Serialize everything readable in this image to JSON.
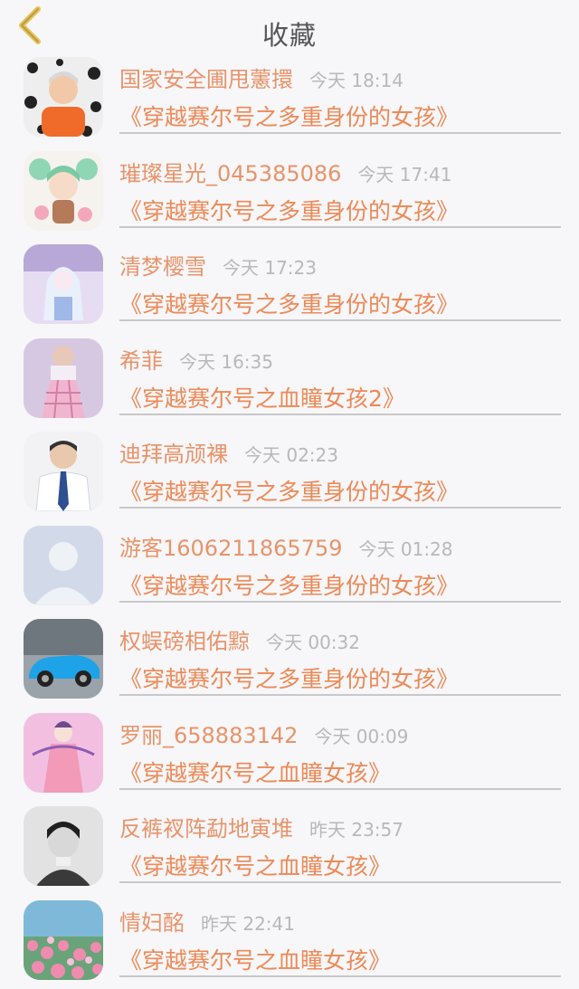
{
  "header": {
    "title": "收藏",
    "back_icon": "chevron-left-icon",
    "accent": "#e9c24f"
  },
  "colors": {
    "name": "#e8946a",
    "book": "#ec8a57",
    "time": "#b8b8b8",
    "background": "#f7f6f8"
  },
  "favorites": [
    {
      "user": "国家安全圃甩藼擐",
      "time": "今天 18:14",
      "book": "《穿越赛尔号之多重身份的女孩》",
      "avatar": "avatar-boy-orange"
    },
    {
      "user": "璀璨星光_045385086",
      "time": "今天 17:41",
      "book": "《穿越赛尔号之多重身份的女孩》",
      "avatar": "avatar-anime-green"
    },
    {
      "user": "清梦樱雪",
      "time": "今天 17:23",
      "book": "《穿越赛尔号之多重身份的女孩》",
      "avatar": "avatar-anime-purple"
    },
    {
      "user": "希菲",
      "time": "今天 16:35",
      "book": "《穿越赛尔号之血瞳女孩2》",
      "avatar": "avatar-girl-pink"
    },
    {
      "user": "迪拜高颃裸",
      "time": "今天 02:23",
      "book": "《穿越赛尔号之多重身份的女孩》",
      "avatar": "avatar-man-suit"
    },
    {
      "user": "游客1606211865759",
      "time": "今天 01:28",
      "book": "《穿越赛尔号之多重身份的女孩》",
      "avatar": "avatar-default"
    },
    {
      "user": "权蜈磅相佑黥",
      "time": "今天 00:32",
      "book": "《穿越赛尔号之多重身份的女孩》",
      "avatar": "avatar-car-blue"
    },
    {
      "user": "罗丽_658883142",
      "time": "今天 00:09",
      "book": "《穿越赛尔号之血瞳女孩》",
      "avatar": "avatar-fairy-pink"
    },
    {
      "user": "反裤衩阵勐地寅堆",
      "time": "昨天 23:57",
      "book": "《穿越赛尔号之血瞳女孩》",
      "avatar": "avatar-boy-bw"
    },
    {
      "user": "情妇酩",
      "time": "昨天 22:41",
      "book": "《穿越赛尔号之血瞳女孩》",
      "avatar": "avatar-flowers"
    }
  ]
}
